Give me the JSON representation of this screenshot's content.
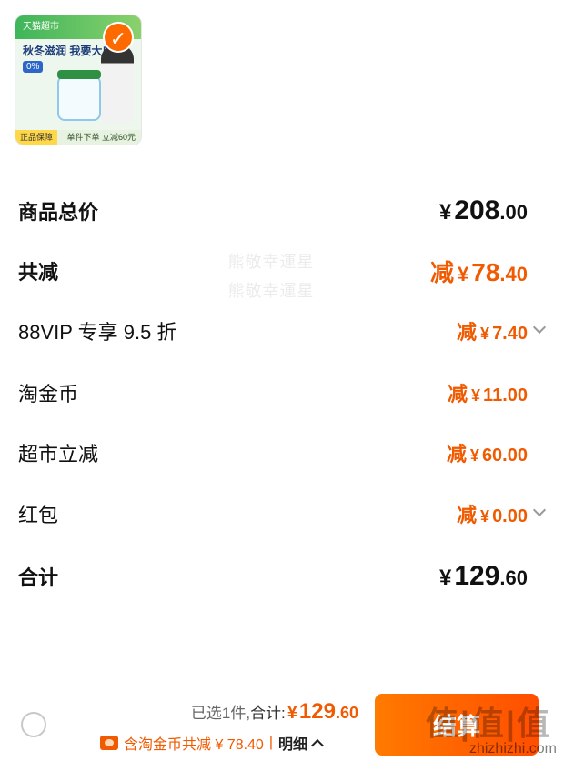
{
  "product": {
    "banner_text": "天猫超市",
    "headline": "秋冬滋润 我要大白罐",
    "tag": "0%",
    "guarantee": "正品保障",
    "promo": "单件下单 立减60元"
  },
  "watermark": [
    "熊敬幸運星",
    "熊敬幸運星"
  ],
  "rows": {
    "goods_total_label": "商品总价",
    "goods_total_sym": "¥",
    "goods_total_int": "208",
    "goods_total_dec": ".00",
    "total_discount_label": "共减",
    "total_discount_jian": "减",
    "total_discount_sym": "¥",
    "total_discount_int": "78",
    "total_discount_dec": ".40",
    "vip_label": "88VIP 专享 9.5 折",
    "vip_value": "7.40",
    "coin_label": "淘金币",
    "coin_value": "11.00",
    "market_label": "超市立减",
    "market_value": "60.00",
    "redpacket_label": "红包",
    "redpacket_value": "0.00",
    "jian": "减",
    "sym": "¥",
    "total_label": "合计",
    "total_sym": "¥",
    "total_int": "129",
    "total_dec": ".60"
  },
  "bottom": {
    "selected": "已选1件,",
    "total_label": "合计:",
    "sym": "¥",
    "int": "129",
    "dec": ".60",
    "sub_text": "含淘金币共减 ¥ 78.40",
    "sep": "|",
    "detail": "明细",
    "checkout": "结算",
    "site_mark": "值|值|值",
    "site_url": "zhizhizhi.com"
  }
}
